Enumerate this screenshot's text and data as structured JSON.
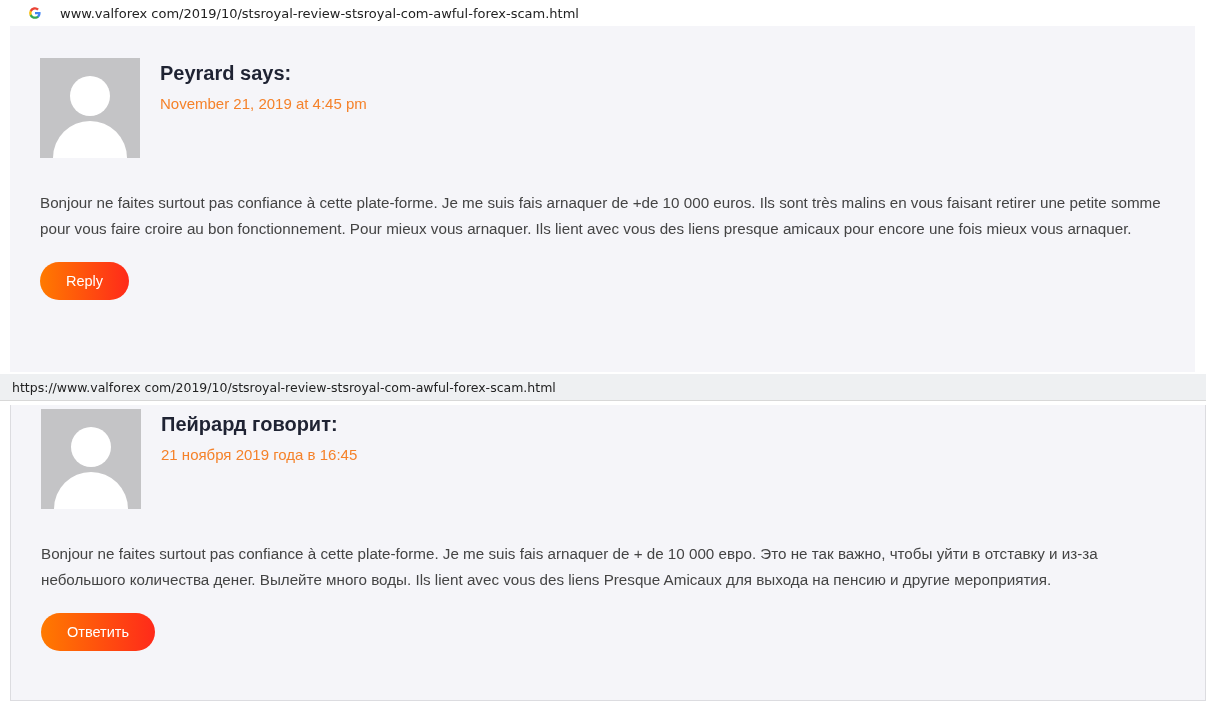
{
  "sections": [
    {
      "address_bar": {
        "url": "www.valforex com/2019/10/stsroyal-review-stsroyal-com-awful-forex-scam.html",
        "logo": true
      },
      "comment": {
        "author": "Peyrard says:",
        "date": "November 21, 2019 at 4:45 pm",
        "text": "Bonjour ne faites surtout pas confiance à cette plate-forme. Je me suis fais arnaquer de +de 10 000 euros. Ils sont très malins en vous faisant retirer une petite somme pour vous faire croire au bon fonctionnement. Pour mieux vous arnaquer. Ils lient avec vous des liens presque amicaux pour encore une fois mieux vous arnaquer.",
        "reply": "Reply"
      }
    },
    {
      "address_bar": {
        "url": "https://www.valforex com/2019/10/stsroyal-review-stsroyal-com-awful-forex-scam.html",
        "logo": false
      },
      "comment": {
        "author": "Пейрард говорит:",
        "date": "21 ноября 2019 года в 16:45",
        "text": "Bonjour ne faites surtout pas confiance à cette plate-forme. Je me suis fais arnaquer de + de 10 000 евро. Это не так важно, чтобы уйти в отставку и из-за небольшого количества денег. Вылейте много воды. Ils lient avec vous des liens Presque Amicaux для выхода на пенсию и другие мероприятия.",
        "reply": "Ответить"
      }
    }
  ]
}
